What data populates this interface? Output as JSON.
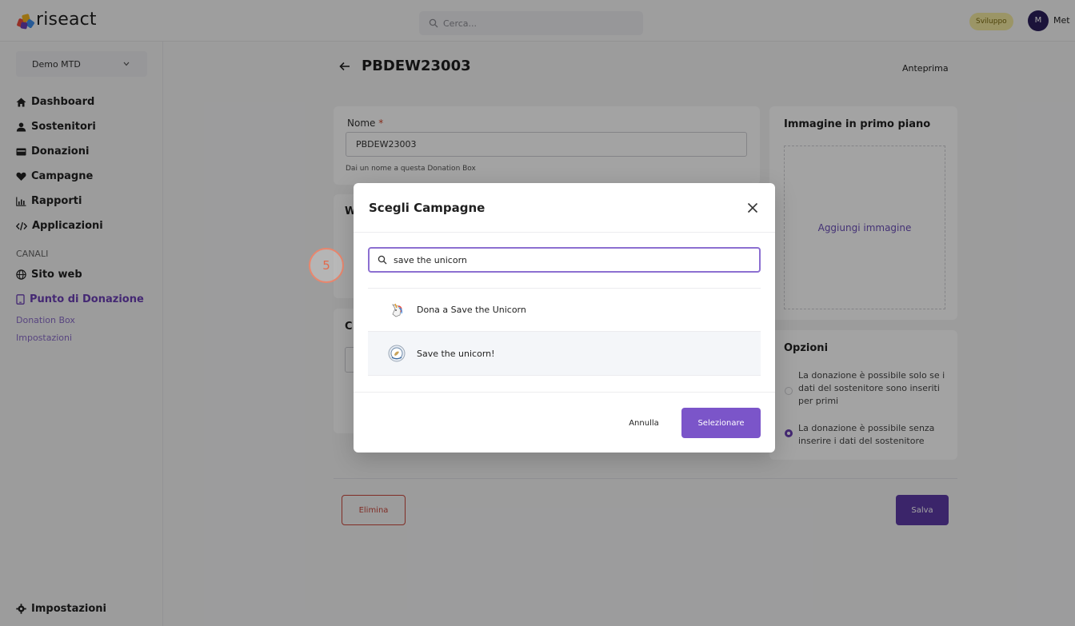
{
  "app": {
    "logo_text": "riseact"
  },
  "topbar": {
    "search_placeholder": "Cerca...",
    "env_badge": "Sviluppo",
    "user_initial": "M",
    "user_name": "Met"
  },
  "sidebar": {
    "org": "Demo MTD",
    "items": [
      {
        "label": "Dashboard",
        "icon": "home-icon"
      },
      {
        "label": "Sostenitori",
        "icon": "user-icon"
      },
      {
        "label": "Donazioni",
        "icon": "wallet-icon"
      },
      {
        "label": "Campagne",
        "icon": "heart-icon"
      },
      {
        "label": "Rapporti",
        "icon": "chart-icon"
      },
      {
        "label": "Applicazioni",
        "icon": "code-icon"
      }
    ],
    "section_channels": "CANALI",
    "channels": [
      {
        "label": "Sito web",
        "icon": "globe-icon"
      },
      {
        "label": "Punto di Donazione",
        "icon": "tablet-icon"
      }
    ],
    "sub_items": [
      "Donation Box",
      "Impostazioni"
    ],
    "settings": "Impostazioni"
  },
  "page": {
    "title": "PBDEW23003",
    "preview": "Anteprima",
    "name_label": "Nome",
    "name_required": "*",
    "name_value": "PBDEW23003",
    "name_hint": "Dai un nome a questa Donation Box",
    "card2_title_partial": "W",
    "card3_title_partial": "C",
    "image_title": "Immagine in primo piano",
    "image_add": "Aggiungi immagine",
    "options_title": "Opzioni",
    "option1": "La donazione è possibile solo se i dati del sostenitore sono inseriti per primi",
    "option2": "La donazione è possibile senza inserire i dati del sostenitore",
    "delete": "Elimina",
    "save": "Salva"
  },
  "step_marker": "5",
  "modal": {
    "title": "Scegli Campagne",
    "search_value": "save the unicorn",
    "results": [
      {
        "label": "Dona a Save the Unicorn"
      },
      {
        "label": "Save the unicorn!"
      }
    ],
    "cancel": "Annulla",
    "select": "Selezionare"
  },
  "colors": {
    "accent": "#7b55c9",
    "save": "#5d3aa6",
    "danger": "#c9473c",
    "badge": "#f3e9a0",
    "marker": "#e2694b"
  }
}
